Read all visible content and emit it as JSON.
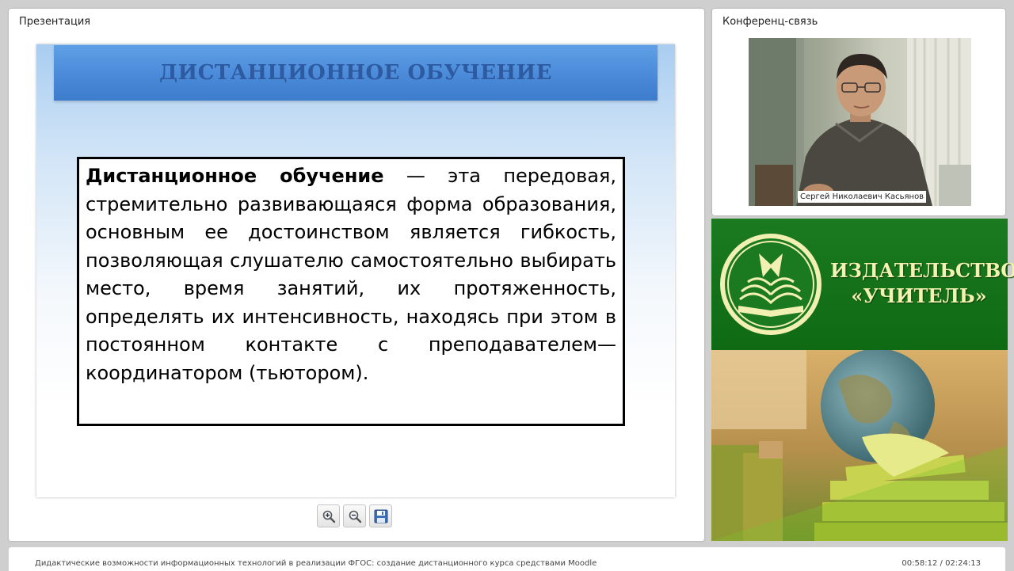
{
  "presentation": {
    "panel_title": "Презентация",
    "slide": {
      "heading": "ДИСТАНЦИОННОЕ ОБУЧЕНИЕ",
      "term": "Дистанционное обучение",
      "definition": " — эта передовая, стремительно развивающаяся форма образования, основным ее достоинством является гибкость, позволяющая слушателю самостоятельно выбирать место, время занятий, их протяженность, определять их интенсивность, находясь при этом в постоянном контакте с преподавателем—координатором (тьютором)."
    },
    "toolbar": {
      "zoom_in_icon": "zoom-in-icon",
      "zoom_out_icon": "zoom-out-icon",
      "save_icon": "save-icon"
    }
  },
  "conference": {
    "panel_title": "Конференц-связь",
    "speaker_name": "Сергей Николаевич Касьянов"
  },
  "publisher": {
    "line1": "ИЗДАТЕЛЬСТВО",
    "line2": "«УЧИТЕЛЬ»"
  },
  "footer": {
    "course_title": "Дидактические возможности информационных технологий в реализации ФГОС: создание дистанционного курса средствами Moodle",
    "time_current": "00:58:12",
    "time_separator": " / ",
    "time_total": "02:24:13"
  },
  "colors": {
    "header_blue": "#4a8ad9",
    "publisher_green": "#0f6a14",
    "publisher_text": "#f3f2b0"
  }
}
